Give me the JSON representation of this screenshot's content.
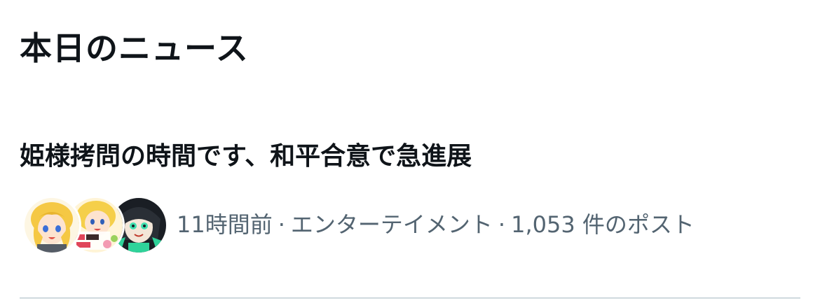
{
  "section": {
    "title": "本日のニュース"
  },
  "news_item": {
    "headline": "姫様拷問の時間です、和平合意で急進展",
    "time_ago": "11時間前",
    "separator": "·",
    "category": "エンターテイメント",
    "post_count": "1,053 件のポスト",
    "avatars": [
      "blonde-anime-character-icon",
      "blonde-anime-character-logo-icon",
      "green-haired-character-icon"
    ]
  },
  "colors": {
    "text_primary": "#0f1419",
    "text_secondary": "#536471",
    "divider": "#cfd9de",
    "background": "#ffffff"
  }
}
